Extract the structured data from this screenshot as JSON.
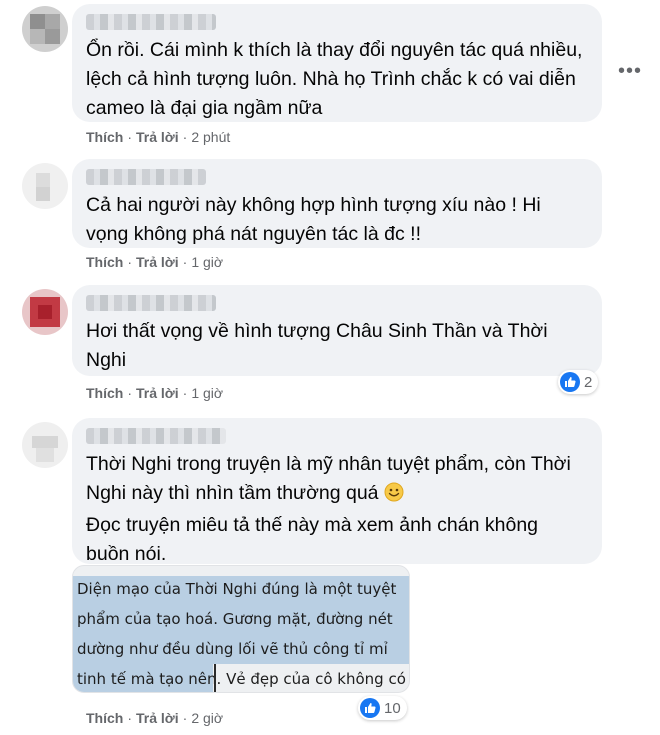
{
  "comments": [
    {
      "text_lines": [
        "Ổn rồi. Cái mình k thích là thay đổi nguyên tác quá nhiều,",
        "lệch cả hình tượng luôn. Nhà họ Trình chắc k có vai diễn",
        "cameo là đại gia ngầm nữa"
      ],
      "like_label": "Thích",
      "reply_label": "Trả lời",
      "time": "2 phút"
    },
    {
      "text_lines": [
        "Cả hai người này không hợp hình tượng xíu nào ! Hi",
        "vọng không phá nát nguyên tác là đc !!"
      ],
      "like_label": "Thích",
      "reply_label": "Trả lời",
      "time": "1 giờ"
    },
    {
      "text_lines": [
        "Hơi thất vọng về hình tượng Châu Sinh Thần và Thời",
        "Nghi"
      ],
      "like_label": "Thích",
      "reply_label": "Trả lời",
      "time": "1 giờ",
      "reaction_count": "2"
    },
    {
      "text_lines": [
        "Thời Nghi trong truyện là mỹ nhân tuyệt phẩm, còn Thời",
        "Nghi này thì nhìn tầm thường quá",
        "Đọc truyện miêu tả thế này mà xem ảnh chán không",
        "buồn nói."
      ],
      "like_label": "Thích",
      "reply_label": "Trả lời",
      "time": "2 giờ",
      "reaction_count": "10",
      "attachment_lines": [
        "Diện mạo của Thời Nghi đúng là một tuyệt",
        "phẩm của tạo hoá. Gương mặt, đường nét",
        "dường như đều dùng lối vẽ thủ công tỉ mỉ",
        "tinh tế mà tạo nên. Vẻ đẹp của cô không có"
      ]
    }
  ],
  "icons": {
    "more": "more-horizontal-icon",
    "like": "like-thumb-icon",
    "emoji": "smiling-face-emoji"
  },
  "colors": {
    "bubble": "#f0f2f5",
    "meta": "#65676b",
    "like_blue": "#1877f2",
    "highlight": "#b9cfe3"
  }
}
